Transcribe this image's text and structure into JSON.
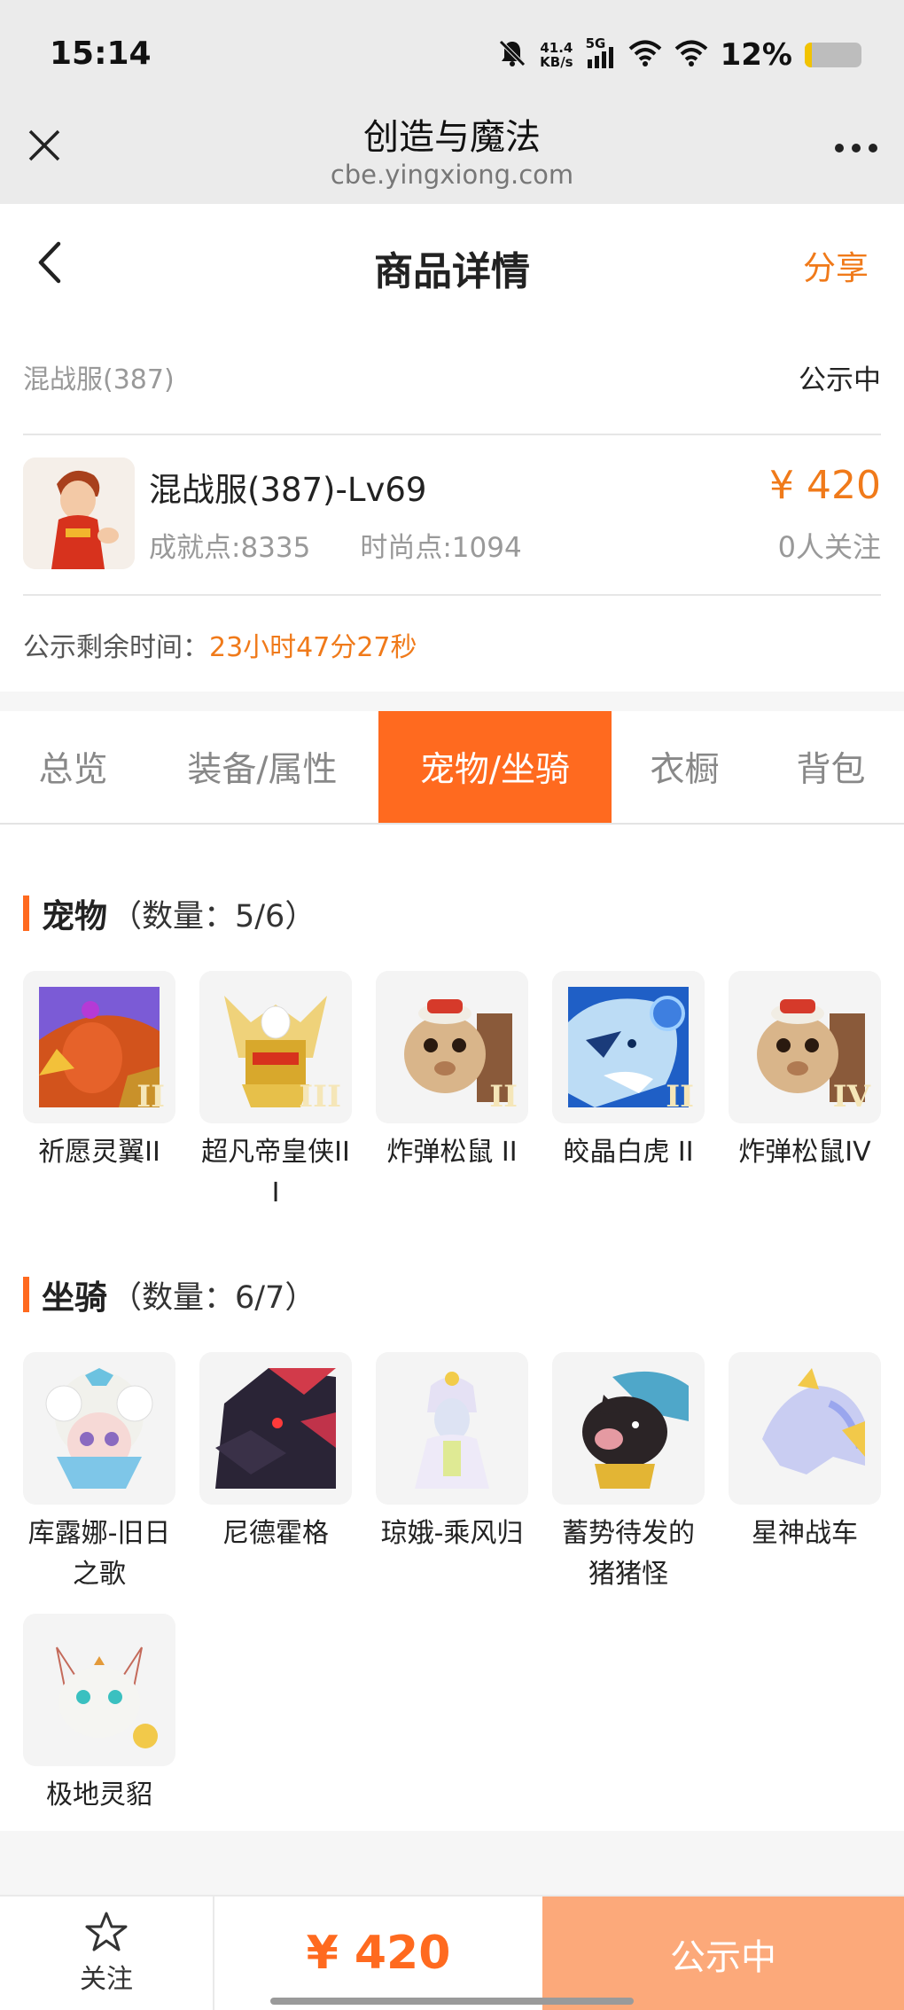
{
  "status_bar": {
    "time": "15:14",
    "net_speed_value": "41.4",
    "net_speed_unit": "KB/s",
    "signal_label": "5G",
    "battery_text": "12%",
    "battery_level": 0.12,
    "icons": [
      "mute-bell-icon",
      "signal-bars-icon",
      "wifi-icon",
      "wifi-icon",
      "battery-icon"
    ]
  },
  "browser": {
    "title": "创造与魔法",
    "url": "cbe.yingxiong.com"
  },
  "header": {
    "title": "商品详情",
    "share_label": "分享"
  },
  "listing": {
    "server": "混战服(387)",
    "status": "公示中",
    "item_name": "混战服(387)-Lv69",
    "achievement": "成就点:8335",
    "fashion": "时尚点:1094",
    "price": "¥ 420",
    "followers": "0人关注",
    "remaining_label": "公示剩余时间：",
    "remaining_time": "23小时47分27秒"
  },
  "tabs": [
    {
      "label": "总览",
      "active": false
    },
    {
      "label": "装备/属性",
      "active": false
    },
    {
      "label": "宠物/坐骑",
      "active": true
    },
    {
      "label": "衣橱",
      "active": false
    },
    {
      "label": "背包",
      "active": false
    }
  ],
  "pets": {
    "title": "宠物",
    "count": "（数量：5/6）",
    "items": [
      {
        "name": "祈愿灵翼II",
        "tier": "II"
      },
      {
        "name": "超凡帝皇侠III",
        "tier": "III"
      },
      {
        "name": "炸弹松鼠 II",
        "tier": "II"
      },
      {
        "name": "皎晶白虎 II",
        "tier": "II"
      },
      {
        "name": "炸弹松鼠IV",
        "tier": "IV"
      }
    ]
  },
  "mounts": {
    "title": "坐骑",
    "count": "（数量：6/7）",
    "items": [
      {
        "name": "库露娜-旧日之歌"
      },
      {
        "name": "尼德霍格"
      },
      {
        "name": "琼娥-乘风归"
      },
      {
        "name": "蓄势待发的猪猪怪"
      },
      {
        "name": "星神战车"
      },
      {
        "name": "极地灵貂"
      }
    ]
  },
  "bottom_bar": {
    "follow_label": "关注",
    "price": "¥ 420",
    "status_button": "公示中"
  },
  "colors": {
    "accent": "#ff6a1f",
    "price": "#f07a1a",
    "status_button": "#fca97a"
  }
}
